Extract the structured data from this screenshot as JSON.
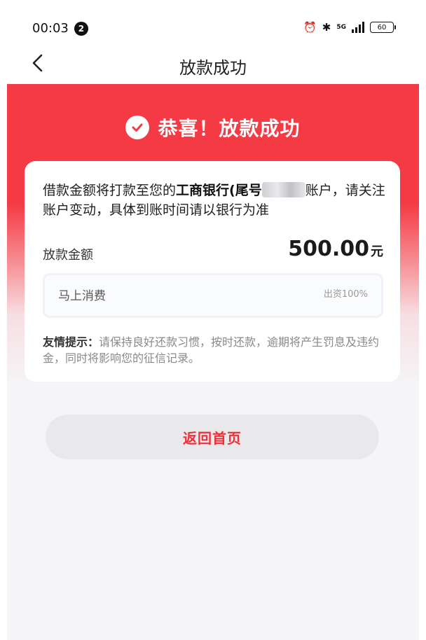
{
  "status_bar": {
    "time": "00:03",
    "notification_count": "2",
    "network_label": "5G",
    "battery_level": "60"
  },
  "nav": {
    "title": "放款成功"
  },
  "hero": {
    "success_text": "恭喜！放款成功"
  },
  "card": {
    "message_prefix": "借款金额将打款至您的",
    "bank_name": "工商银行(尾号",
    "message_suffix": "账户，请关注账户变动，具体到账时间请以银行为准",
    "amount_label": "放款金额",
    "amount_value": "500.00",
    "amount_unit": "元",
    "loan_product": "马上消费",
    "funding_percent": "出资100%",
    "tip_label": "友情提示：",
    "tip_text": "请保持良好还款习惯，按时还款，逾期将产生罚息及违约金，同时将影响您的征信记录。"
  },
  "actions": {
    "home_button_label": "返回首页"
  },
  "colors": {
    "brand_red": "#f43a44",
    "button_text_red": "#ef2f3a",
    "background": "#f5f5f7"
  }
}
